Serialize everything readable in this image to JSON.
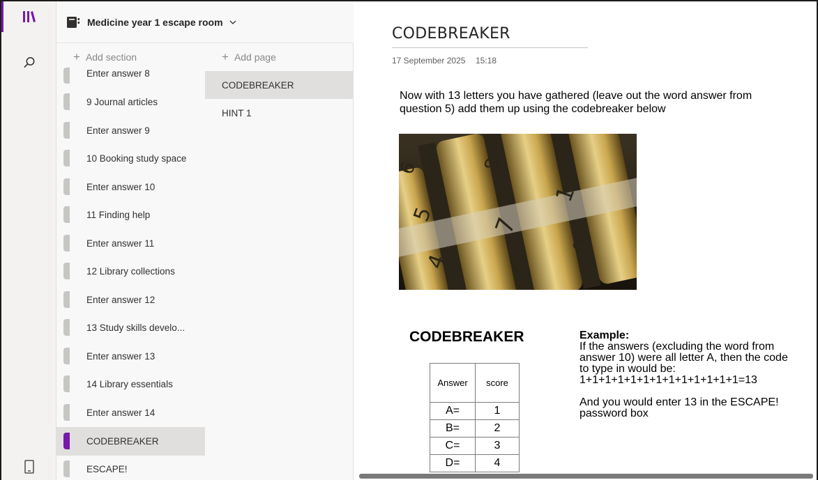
{
  "notebook": {
    "title": "Medicine year 1 escape room"
  },
  "sections_pane": {
    "add_label": "Add section",
    "items": [
      {
        "label": "Enter answer 8"
      },
      {
        "label": "9 Journal articles"
      },
      {
        "label": "Enter answer 9"
      },
      {
        "label": "10 Booking study space"
      },
      {
        "label": "Enter answer 10"
      },
      {
        "label": "11 Finding help"
      },
      {
        "label": "Enter answer 11"
      },
      {
        "label": "12 Library collections"
      },
      {
        "label": "Enter answer 12"
      },
      {
        "label": "13 Study skills develo..."
      },
      {
        "label": "Enter answer 13"
      },
      {
        "label": "14 Library essentials"
      },
      {
        "label": "Enter answer 14"
      },
      {
        "label": "CODEBREAKER"
      },
      {
        "label": "ESCAPE!"
      }
    ]
  },
  "pages_pane": {
    "add_label": "Add page",
    "items": [
      {
        "label": "CODEBREAKER"
      },
      {
        "label": "HINT 1"
      }
    ]
  },
  "page": {
    "title": "CODEBREAKER",
    "date": "17 September 2025",
    "time": "15:18",
    "intro": "Now with 13 letters you have gathered (leave out the word answer from question 5) add them up using the codebreaker below",
    "codebreaker_heading": "CODEBREAKER",
    "table": {
      "headers": [
        "Answer",
        "score"
      ],
      "rows": [
        [
          "A=",
          "1"
        ],
        [
          "B=",
          "2"
        ],
        [
          "C=",
          "3"
        ],
        [
          "D=",
          "4"
        ]
      ]
    },
    "example": {
      "title": "Example:",
      "line1": "If the answers (excluding the word from answer 10) were all letter A, then the code to type in would be:",
      "line2": "1+1+1+1+1+1+1+1+1+1+1+1+1=13",
      "line3": "And you would enter 13 in the ESCAPE! password box"
    }
  },
  "colors": {
    "accent": "#7719aa",
    "selected_bg": "#e1dfdd"
  }
}
